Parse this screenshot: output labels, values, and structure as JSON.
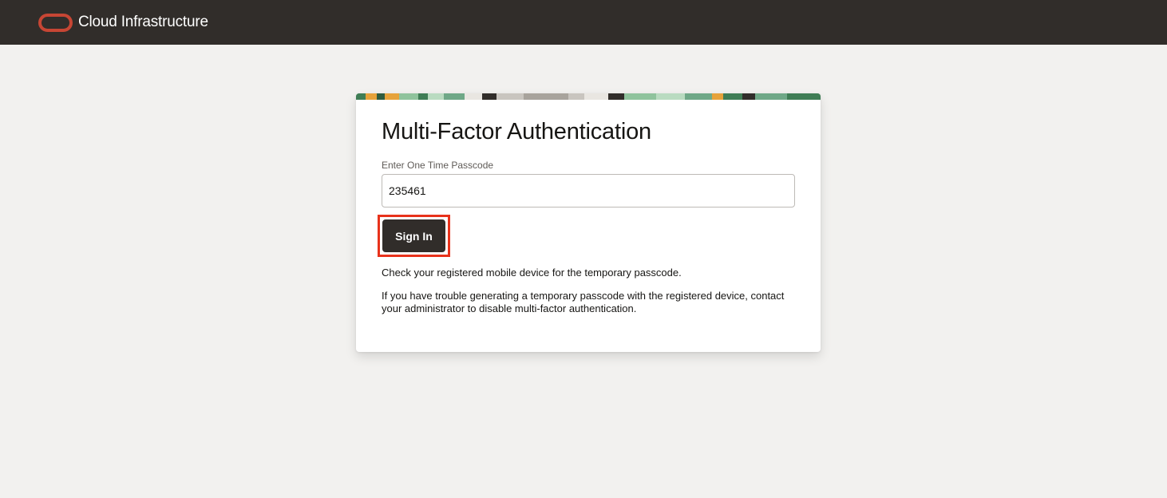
{
  "header": {
    "brand": "Cloud Infrastructure",
    "logo_icon": "oracle-logo-icon",
    "logo_color": "#c74634",
    "background_color": "#312d2a"
  },
  "card": {
    "title": "Multi-Factor Authentication",
    "passcode_label": "Enter One Time Passcode",
    "passcode_value": "235461",
    "signin_label": "Sign In",
    "help_text_1": "Check your registered mobile device for the temporary passcode.",
    "help_text_2": "If you have trouble generating a temporary passcode with the registered device, contact your administrator to disable multi-factor authentication.",
    "highlight_color": "#e8321b"
  }
}
